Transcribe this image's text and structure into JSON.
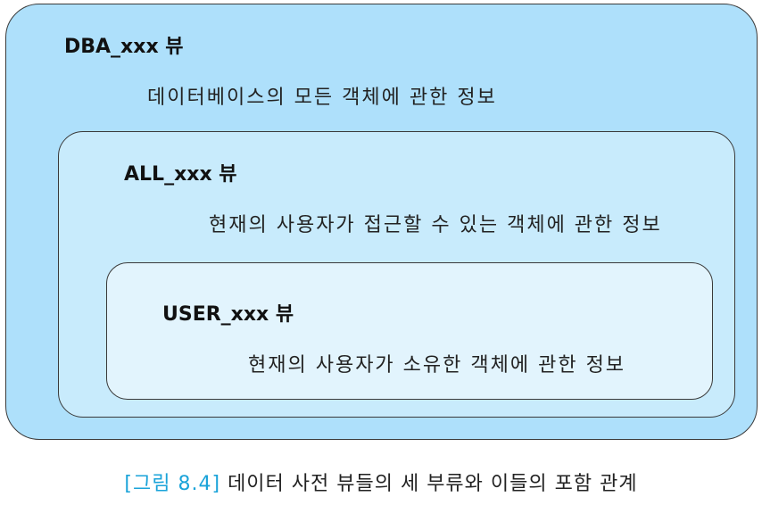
{
  "diagram": {
    "dba": {
      "title": "DBA_xxx 뷰",
      "description": "데이터베이스의 모든 객체에 관한 정보"
    },
    "all": {
      "title": "ALL_xxx 뷰",
      "description": "현재의 사용자가 접근할 수 있는 객체에 관한 정보"
    },
    "user": {
      "title": "USER_xxx 뷰",
      "description": "현재의 사용자가 소유한 객체에 관한 정보"
    }
  },
  "caption": {
    "figure_label": "[그림 8.4]",
    "text": "데이터 사전 뷰들의 세 부류와 이들의 포함 관계"
  },
  "colors": {
    "dba_fill": "#aee0fb",
    "all_fill": "#c8ebfc",
    "user_fill": "#e2f4fd",
    "caption_accent": "#1aa3d9"
  }
}
